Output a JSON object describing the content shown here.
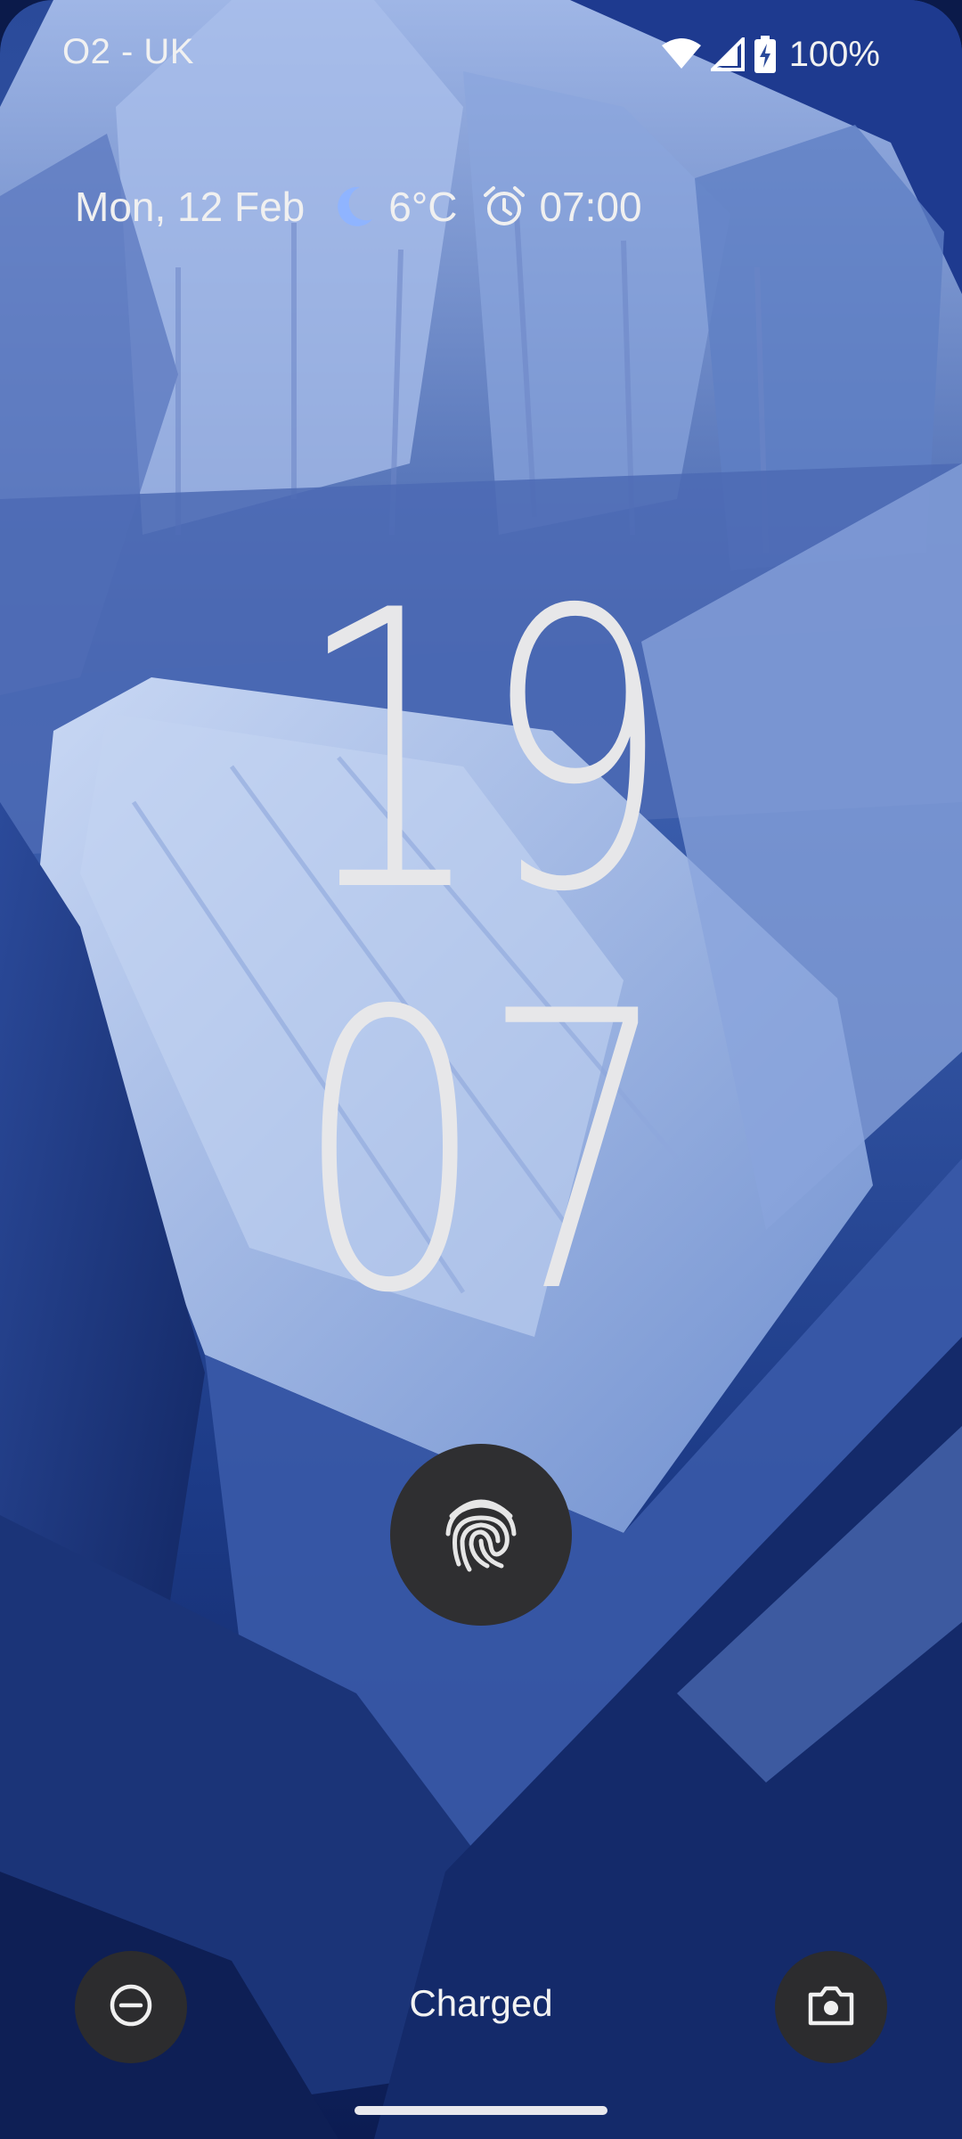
{
  "status_bar": {
    "carrier": "O2 - UK",
    "battery_percent": "100%",
    "icons": [
      "wifi-icon",
      "cellular-signal-icon",
      "battery-charging-icon"
    ]
  },
  "smartspace": {
    "date": "Mon, 12 Feb",
    "weather_icon": "moon-icon",
    "temperature": "6°C",
    "alarm_icon": "alarm-clock-icon",
    "alarm_time": "07:00"
  },
  "clock": {
    "hours": "19",
    "minutes": "07"
  },
  "lock_screen": {
    "fingerprint_icon": "fingerprint-icon",
    "indication": "Charged",
    "left_shortcut_icon": "do-not-disturb-icon",
    "right_shortcut_icon": "camera-icon"
  },
  "colors": {
    "wallpaper_dark": "#0e2260",
    "wallpaper_light": "#b9cdf0",
    "clock_text": "#e7e7e9",
    "button_bg": "#2c2c2e",
    "moon": "#8fb4ff"
  }
}
